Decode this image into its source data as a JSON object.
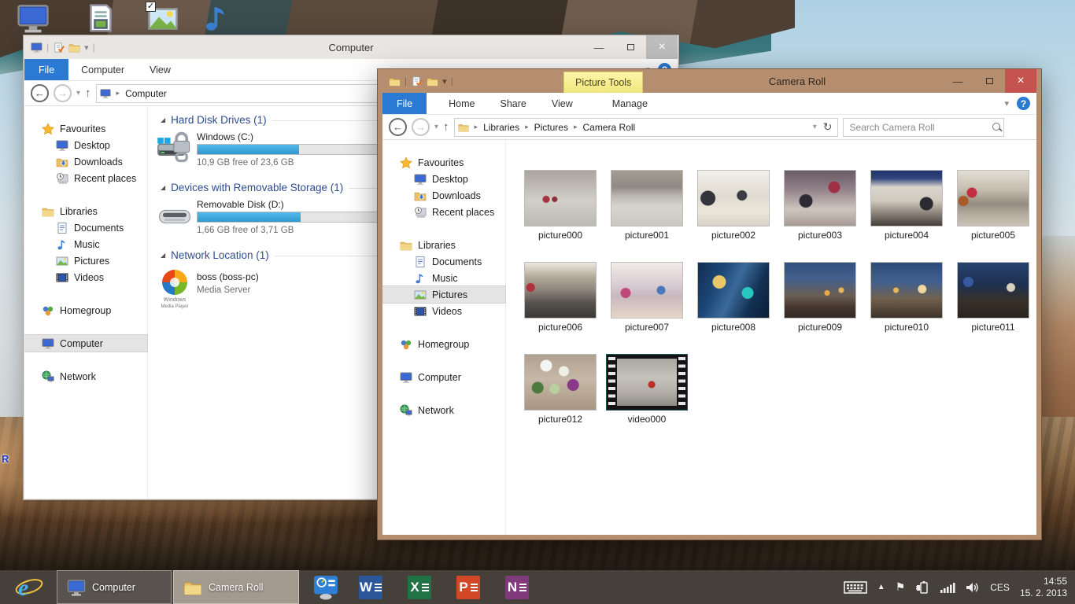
{
  "nav": {
    "favourites": "Favourites",
    "desktop": "Desktop",
    "downloads": "Downloads",
    "recent": "Recent places",
    "libraries": "Libraries",
    "documents": "Documents",
    "music": "Music",
    "pictures": "Pictures",
    "videos": "Videos",
    "homegroup": "Homegroup",
    "computer": "Computer",
    "network": "Network"
  },
  "back": {
    "title": "Computer",
    "tabs": {
      "file": "File",
      "computer": "Computer",
      "view": "View"
    },
    "crumb_root": "Computer",
    "g1_title": "Hard Disk Drives (1)",
    "g2_title": "Devices with Removable Storage (1)",
    "g3_title": "Network Location (1)",
    "c_name": "Windows (C:)",
    "c_detail": "10,9 GB free of 23,6 GB",
    "c_bar": "width:54%",
    "d_name": "Removable Disk (D:)",
    "d_detail": "1,66 GB free of 3,71 GB",
    "d_bar": "width:55%",
    "n_name": "boss (boss-pc)",
    "n_detail": "Media Server",
    "wmp1": "Windows",
    "wmp2": "Media Player"
  },
  "front": {
    "title": "Camera Roll",
    "contextual": "Picture Tools",
    "tabs": {
      "file": "File",
      "home": "Home",
      "share": "Share",
      "view": "View",
      "manage": "Manage"
    },
    "crumb": [
      "Libraries",
      "Pictures",
      "Camera Roll"
    ],
    "search_ph": "Search Camera Roll",
    "items": [
      {
        "label": "picture000",
        "style": "background:radial-gradient(circle at 30% 52%,#a8323e 0 4px,transparent 5px),radial-gradient(circle at 42% 52%,#8d2d3a 0 3px,transparent 4px),linear-gradient(180deg,#aaa69f 0%,#c0bcb5 30%,#d2cfc9 55%,#bdbab3 100%)"
      },
      {
        "label": "picture001",
        "style": "background:linear-gradient(180deg,#a39c92 0%,#8f8a84 30%,#b9b5ae 45%,#d8d5cf 65%,#cac7c0 100%)"
      },
      {
        "label": "picture002",
        "style": "background:radial-gradient(circle at 14% 50%,#34343c 0 9px,transparent 10px),radial-gradient(circle at 62% 45%,#3c3c44 0 6px,transparent 7px),linear-gradient(180deg,#f2f0ea 0%,#e0dbd2 45%,#ece6da 75%,#d8d2c6 100%)"
      },
      {
        "label": "picture003",
        "style": "background:radial-gradient(circle at 70% 30%,#a03048 0 7px,transparent 8px),radial-gradient(circle at 30% 55%,#2e2a33 0 8px,transparent 9px),linear-gradient(180deg,#6a5a63 0%,#93838a 35%,#cfc5bf 70%,#a89a94 100%)"
      },
      {
        "label": "picture004",
        "style": "background:radial-gradient(circle at 78% 60%,#2a2a30 0 8px,transparent 9px),linear-gradient(180deg,#20336b 0%,#32457d 14%,#d9d5cd 30%,#cfc9bd 55%,#8a8077 78%,#453f3a 100%)"
      },
      {
        "label": "picture005",
        "style": "background:radial-gradient(circle at 20% 40%,#c03040 0 6px,transparent 7px),radial-gradient(circle at 8% 55%,#a85a28 0 6px,transparent 7px),linear-gradient(180deg,#e2ded4 0%,#c4bcae 35%,#958c80 60%,#b5ada0 80%,#cac2b5 100%)"
      },
      {
        "label": "picture006",
        "style": "background:radial-gradient(circle at 8% 45%,#b03038 0 5px,transparent 6px),linear-gradient(180deg,#ece8de 0%,#b5ab9c 25%,#8d847a 50%,#57534f 72%,#3b3835 100%)"
      },
      {
        "label": "picture007",
        "style": "background:radial-gradient(circle at 20% 55%,#c04878 0 6px,transparent 7px),radial-gradient(circle at 70% 50%,#4878b8 0 5px,transparent 6px),linear-gradient(180deg,#f0ebe6 0%,#ddd0d6 35%,#c8b8c0 60%,#e6d6c6 100%)"
      },
      {
        "label": "picture008",
        "style": "background:radial-gradient(circle at 30% 35%,#e8c868 0 8px,transparent 9px),radial-gradient(circle at 70% 55%,#28c8c0 0 7px,transparent 8px),linear-gradient(115deg,#122c52 0%,#1d4878 30%,#3a6a9a 50%,#133052 75%,#0c1e38 100%)"
      },
      {
        "label": "picture009",
        "style": "background:radial-gradient(circle at 60% 55%,#e8a848 0 3px,transparent 4px),radial-gradient(circle at 80% 50%,#e8b858 0 3px,transparent 4px),linear-gradient(180deg,#31507e 0%,#44608c 30%,#6a5e52 60%,#46382f 80%,#332a24 100%)"
      },
      {
        "label": "picture010",
        "style": "background:radial-gradient(circle at 35% 50%,#e8b858 0 3px,transparent 4px),radial-gradient(circle at 72% 48%,#f0d8a0 0 5px,transparent 6px),linear-gradient(180deg,#2e4c78 0%,#41608e 35%,#71624f 65%,#3e332b 100%)"
      },
      {
        "label": "picture011",
        "style": "background:radial-gradient(circle at 75% 45%,#d8d0c0 0 5px,transparent 6px),radial-gradient(circle at 15% 35%,#3858a0 0 6px,transparent 7px),linear-gradient(180deg,#26426e 0%,#1e3050 40%,#383028 70%,#272320 100%)"
      },
      {
        "label": "picture012",
        "style": "background:radial-gradient(circle at 30% 20%,#f4f4f0 0 7px,transparent 8px),radial-gradient(circle at 55% 30%,#eeeee8 0 6px,transparent 7px),radial-gradient(circle at 68% 55%,#8a3888 0 7px,transparent 8px),radial-gradient(circle at 18% 60%,#4e7a42 0 7px,transparent 8px),radial-gradient(circle at 42% 62%,#b8d0a0 0 6px,transparent 7px),linear-gradient(180deg,#b0a090 0%,#c6b8a6 45%,#a89682 100%)"
      }
    ],
    "video": {
      "label": "video000",
      "inner_style": "background:radial-gradient(circle at 58% 55%,#b83028 0 4px,transparent 5px),linear-gradient(180deg,#a9a59f 0%,#c6c2bc 40%,#b3afa8 70%,#8f8b85 100%)"
    }
  },
  "taskbar": {
    "computer": "Computer",
    "camera_roll": "Camera Roll",
    "office": [
      {
        "name": "word",
        "letter": "W",
        "color": "#2b579a"
      },
      {
        "name": "excel",
        "letter": "X",
        "color": "#217346"
      },
      {
        "name": "powerpoint",
        "letter": "P",
        "color": "#d24726"
      },
      {
        "name": "onenote",
        "letter": "N",
        "color": "#80397b"
      }
    ],
    "tray": {
      "lang": "CES",
      "time": "14:55",
      "date": "15. 2. 2013"
    }
  },
  "desktop": {
    "partial_label": "R"
  },
  "colors": {
    "active_frame": "#b48e6e",
    "ribbon_file_blue": "#2a7ad4",
    "close_red": "#c4524e",
    "group_header_blue": "#2e4c8f",
    "disk_bar_blue": "#2d9ad0",
    "picture_tools_yellow": "#f1e67e"
  }
}
